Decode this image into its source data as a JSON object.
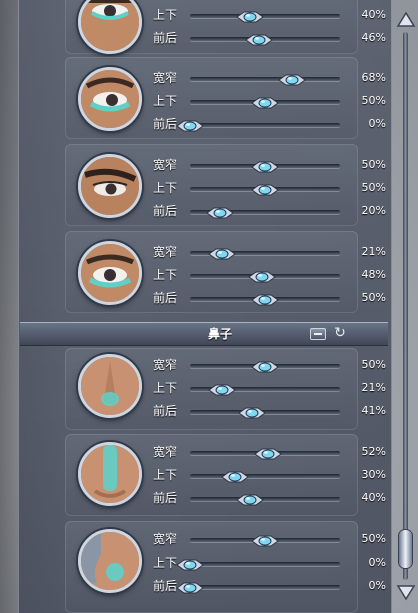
{
  "section": {
    "title": "鼻子",
    "icons": {
      "collapse": "minus-icon",
      "reset": "reset-icon"
    }
  },
  "eye_groups": [
    {
      "rows": [
        {
          "label": "上下",
          "value": "40%",
          "level": 0.4
        },
        {
          "label": "前后",
          "value": "46%",
          "level": 0.46
        }
      ]
    },
    {
      "rows": [
        {
          "label": "宽窄",
          "value": "68%",
          "level": 0.68
        },
        {
          "label": "上下",
          "value": "50%",
          "level": 0.5
        },
        {
          "label": "前后",
          "value": "0%",
          "level": 0.0
        }
      ]
    },
    {
      "rows": [
        {
          "label": "宽窄",
          "value": "50%",
          "level": 0.5
        },
        {
          "label": "上下",
          "value": "50%",
          "level": 0.5
        },
        {
          "label": "前后",
          "value": "20%",
          "level": 0.2
        }
      ]
    },
    {
      "rows": [
        {
          "label": "宽窄",
          "value": "21%",
          "level": 0.21
        },
        {
          "label": "上下",
          "value": "48%",
          "level": 0.48
        },
        {
          "label": "前后",
          "value": "50%",
          "level": 0.5
        }
      ]
    }
  ],
  "nose_groups": [
    {
      "rows": [
        {
          "label": "宽窄",
          "value": "50%",
          "level": 0.5
        },
        {
          "label": "上下",
          "value": "21%",
          "level": 0.21
        },
        {
          "label": "前后",
          "value": "41%",
          "level": 0.41
        }
      ]
    },
    {
      "rows": [
        {
          "label": "宽窄",
          "value": "52%",
          "level": 0.52
        },
        {
          "label": "上下",
          "value": "30%",
          "level": 0.3
        },
        {
          "label": "前后",
          "value": "40%",
          "level": 0.4
        }
      ]
    },
    {
      "rows": [
        {
          "label": "宽窄",
          "value": "50%",
          "level": 0.5
        },
        {
          "label": "上下",
          "value": "0%",
          "level": 0.0
        },
        {
          "label": "前后",
          "value": "0%",
          "level": 0.0
        }
      ]
    }
  ],
  "colors": {
    "highlight": "#5fd0c8",
    "skin": "#c58d68",
    "panel": "#555c6b"
  },
  "scrollbar": {
    "level": 0.95
  }
}
